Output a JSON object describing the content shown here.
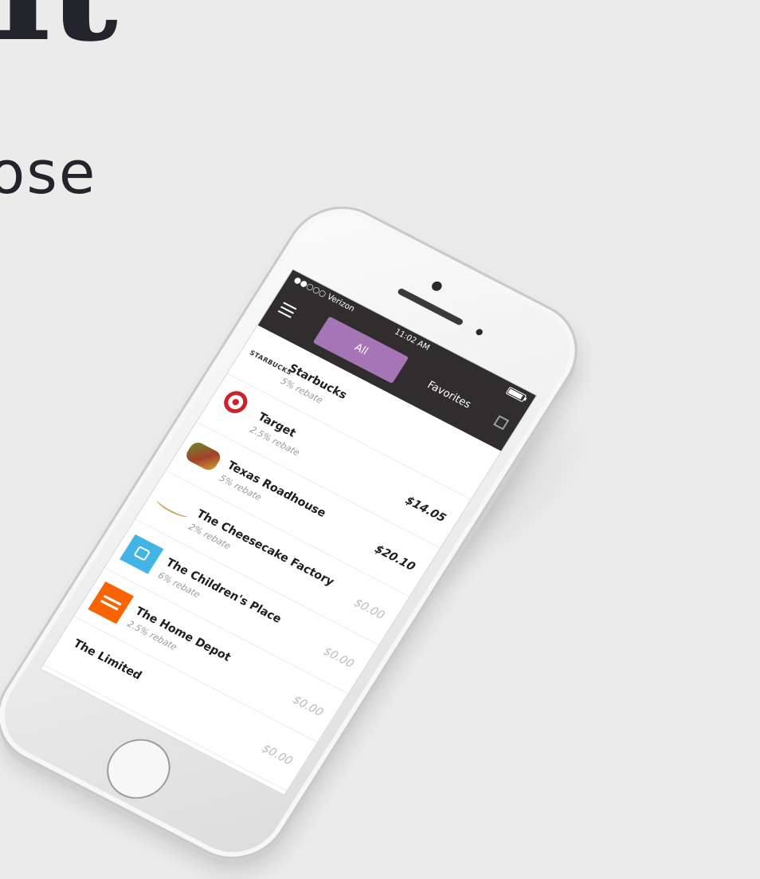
{
  "banner": {
    "headline_fragment": "it",
    "subline_fragment": "ose"
  },
  "status_bar": {
    "carrier": "●●○○○ Verizon",
    "time": "11:02 AM"
  },
  "tabs": [
    {
      "label": "All",
      "selected": true
    },
    {
      "label": "Favorites",
      "selected": false
    }
  ],
  "colors": {
    "accent": "#a675b5",
    "header_bg": "#302d2f"
  },
  "merchants": [
    {
      "name": "Starbucks",
      "rebate": "5% rebate",
      "amount": "",
      "logo_text": "STARBUCKS"
    },
    {
      "name": "Target",
      "rebate": "2.5% rebate",
      "amount": "$14.05",
      "logo_text": ""
    },
    {
      "name": "Texas Roadhouse",
      "rebate": "5% rebate",
      "amount": "$20.10",
      "logo_text": ""
    },
    {
      "name": "The Cheesecake Factory",
      "rebate": "2% rebate",
      "amount": "$0.00",
      "logo_text": ""
    },
    {
      "name": "The Children's Place",
      "rebate": "6% rebate",
      "amount": "$0.00",
      "logo_text": ""
    },
    {
      "name": "The Home Depot",
      "rebate": "2.5% rebate",
      "amount": "$0.00",
      "logo_text": ""
    },
    {
      "name": "The Limited",
      "rebate": "",
      "amount": "$0.00",
      "logo_text": ""
    }
  ]
}
